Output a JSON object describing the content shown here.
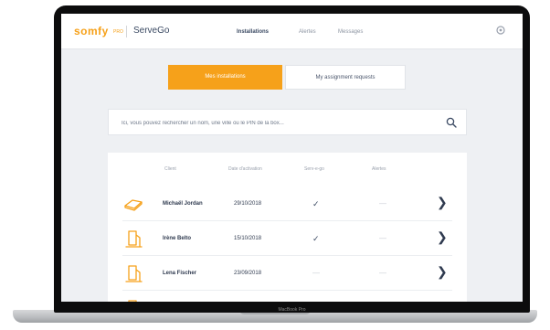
{
  "brand": {
    "logo_main": "somfy",
    "logo_sub": "PRO",
    "app_name": "ServeGo",
    "accent_color": "#f6a11a"
  },
  "nav": {
    "items": [
      {
        "label": "Installations",
        "active": true
      },
      {
        "label": "Alertes",
        "active": false
      },
      {
        "label": "Messages",
        "active": false
      }
    ],
    "settings_icon": "gear-icon"
  },
  "tabs": [
    {
      "label": "Mes installations",
      "active": true
    },
    {
      "label": "My assignment requests",
      "active": false
    }
  ],
  "search": {
    "placeholder": "Ici, vous pouvez rechercher un nom, une ville ou le PIN de la box...",
    "icon": "search-icon"
  },
  "table": {
    "columns": [
      "Client",
      "Date d'activation",
      "Serv-e-go",
      "Alertes"
    ],
    "rows": [
      {
        "name": "Michaël Jordan",
        "date": "29/10/2018",
        "servego": "✓",
        "alerts": "—",
        "device": "tahoma-box-icon"
      },
      {
        "name": "Irène Belto",
        "date": "15/10/2018",
        "servego": "✓",
        "alerts": "—",
        "device": "connexoon-icon"
      },
      {
        "name": "Lena Fischer",
        "date": "23/09/2018",
        "servego": "—",
        "alerts": "—",
        "device": "connexoon-icon"
      }
    ],
    "row_action_icon": "chevron-right-icon"
  },
  "laptop": {
    "label": "MacBook Pro"
  }
}
